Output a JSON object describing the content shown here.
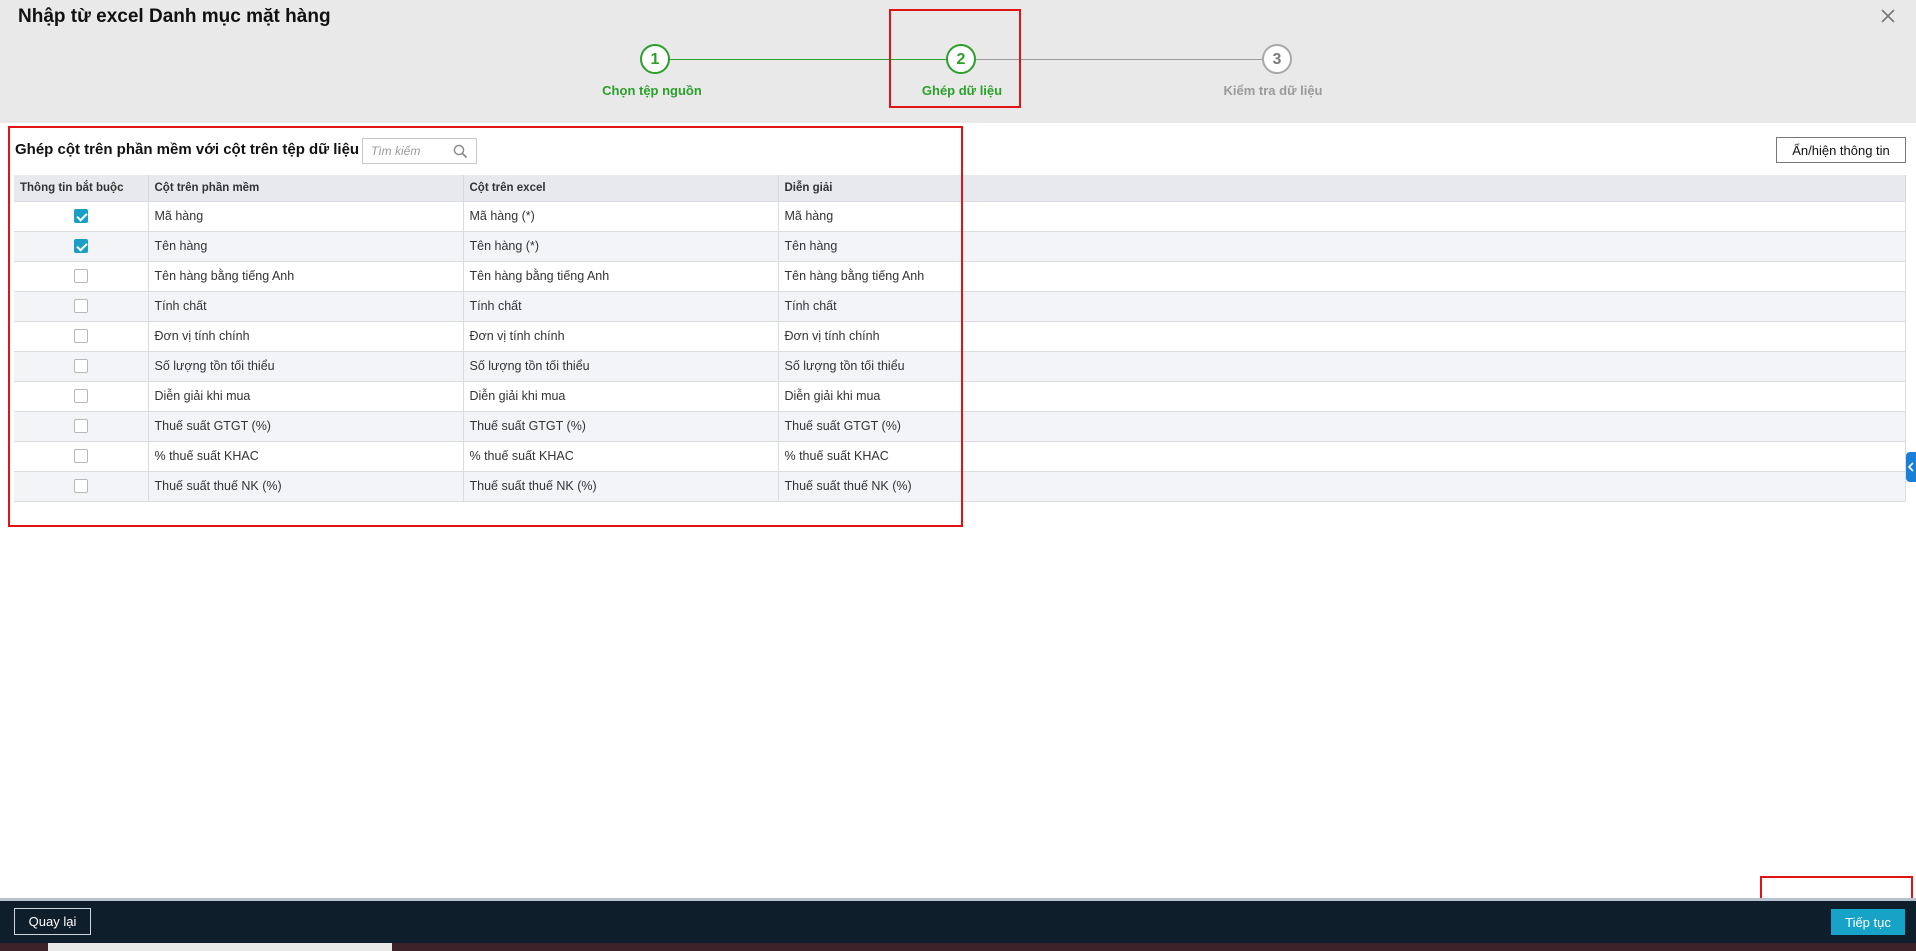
{
  "dialog": {
    "title": "Nhập từ excel Danh mục mặt hàng"
  },
  "stepper": {
    "steps": [
      {
        "number": "1",
        "label": "Chọn tệp nguồn",
        "state": "done"
      },
      {
        "number": "2",
        "label": "Ghép dữ liệu",
        "state": "current"
      },
      {
        "number": "3",
        "label": "Kiểm tra dữ liệu",
        "state": "pending"
      }
    ]
  },
  "section": {
    "title": "Ghép cột trên phần mềm với cột trên tệp dữ liệu",
    "search_placeholder": "Tìm kiếm",
    "toggle_info_label": "Ẩn/hiện thông tin"
  },
  "table": {
    "headers": [
      "Thông tin bắt buộc",
      "Cột trên phần mềm",
      "Cột trên excel",
      "Diễn giải"
    ],
    "rows": [
      {
        "required": true,
        "software": "Mã hàng",
        "excel": "Mã hàng (*)",
        "desc": "Mã hàng"
      },
      {
        "required": true,
        "software": "Tên hàng",
        "excel": "Tên hàng (*)",
        "desc": "Tên hàng"
      },
      {
        "required": false,
        "software": "Tên hàng bằng tiếng Anh",
        "excel": "Tên hàng bằng tiếng Anh",
        "desc": "Tên hàng bằng tiếng Anh"
      },
      {
        "required": false,
        "software": "Tính chất",
        "excel": "Tính chất",
        "desc": "Tính chất"
      },
      {
        "required": false,
        "software": "Đơn vị tính chính",
        "excel": "Đơn vị tính chính",
        "desc": "Đơn vị tính chính"
      },
      {
        "required": false,
        "software": "Số lượng tồn tối thiểu",
        "excel": "Số lượng tồn tối thiểu",
        "desc": "Số lượng tồn tối thiểu"
      },
      {
        "required": false,
        "software": "Diễn giải khi mua",
        "excel": "Diễn giải khi mua",
        "desc": "Diễn giải khi mua"
      },
      {
        "required": false,
        "software": "Thuế suất GTGT (%)",
        "excel": "Thuế suất GTGT (%)",
        "desc": "Thuế suất GTGT (%)"
      },
      {
        "required": false,
        "software": "% thuế suất KHAC",
        "excel": "% thuế suất KHAC",
        "desc": "% thuế suất KHAC"
      },
      {
        "required": false,
        "software": "Thuế suất thuế NK (%)",
        "excel": "Thuế suất thuế NK (%)",
        "desc": "Thuế suất thuế NK (%)"
      }
    ]
  },
  "footer": {
    "back_label": "Quay lại",
    "next_label": "Tiếp tục"
  },
  "colors": {
    "step_active": "#2aa02a",
    "checkbox_checked": "#1a9fc4",
    "footer_bg": "#0f1e2b",
    "next_button": "#17a2c7",
    "highlight_box": "#e01414"
  },
  "icons": {
    "close": "close-icon",
    "search": "search-icon",
    "checkbox_checked": "checkbox-checked-icon",
    "side_panel": "chevron-left-icon"
  }
}
